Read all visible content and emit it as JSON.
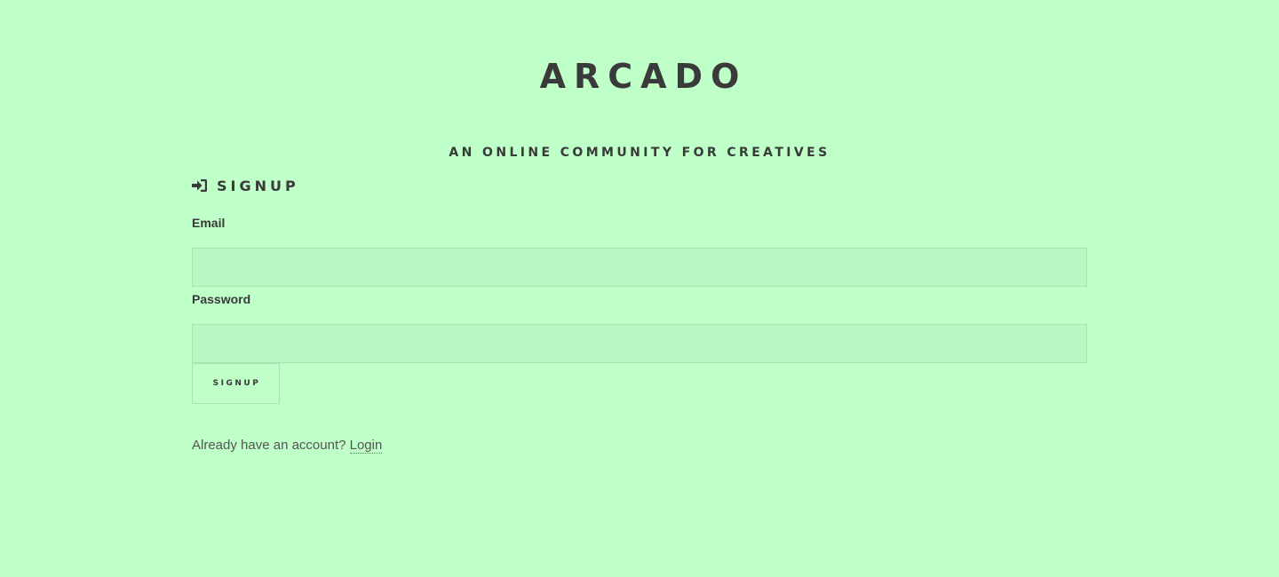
{
  "header": {
    "site_title": "ARCADO",
    "tagline": "AN ONLINE COMMUNITY FOR CREATIVES"
  },
  "signup_form": {
    "heading": "SIGNUP",
    "heading_icon": "sign-in-icon",
    "email": {
      "label": "Email",
      "value": "",
      "placeholder": ""
    },
    "password": {
      "label": "Password",
      "value": "",
      "placeholder": ""
    },
    "submit_label": "SIGNUP"
  },
  "footer": {
    "prompt": "Already have an account?",
    "login_link": "Login"
  },
  "colors": {
    "background": "#bfffc8",
    "text": "#3a3a3a",
    "input_background": "#b8f8c3",
    "border": "#a8e4b3"
  }
}
